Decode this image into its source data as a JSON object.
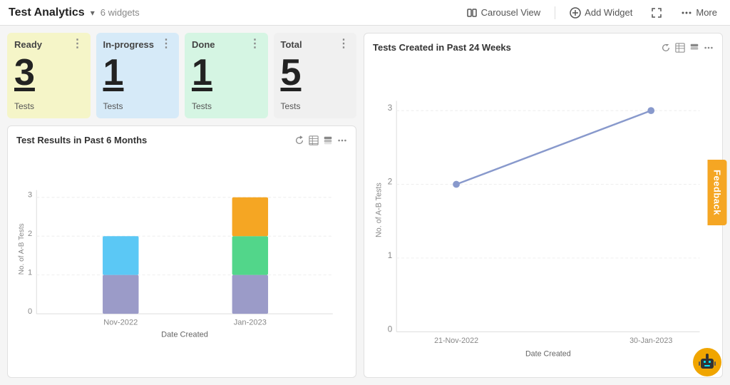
{
  "header": {
    "title": "Test Analytics",
    "arrow": "▾",
    "widgets_label": "6 widgets",
    "carousel_view_label": "Carousel View",
    "add_widget_label": "Add Widget",
    "more_label": "More"
  },
  "stat_cards": [
    {
      "id": "ready",
      "label": "Ready",
      "value": "3",
      "sub_label": "Tests",
      "color_class": "card-ready"
    },
    {
      "id": "inprogress",
      "label": "In-progress",
      "value": "1",
      "sub_label": "Tests",
      "color_class": "card-inprogress"
    },
    {
      "id": "done",
      "label": "Done",
      "value": "1",
      "sub_label": "Tests",
      "color_class": "card-done"
    },
    {
      "id": "total",
      "label": "Total",
      "value": "5",
      "sub_label": "Tests",
      "color_class": "card-total"
    }
  ],
  "bar_chart": {
    "title": "Test Results in Past 6 Months",
    "x_label": "Date Created",
    "y_label": "No. of A-B Tests",
    "bars": [
      {
        "date": "Nov-2022",
        "segments": [
          {
            "value": 1,
            "color": "#9b9bc8"
          },
          {
            "value": 1,
            "color": "#5bc8f5"
          }
        ]
      },
      {
        "date": "Jan-2023",
        "segments": [
          {
            "value": 1,
            "color": "#9b9bc8"
          },
          {
            "value": 1,
            "color": "#52d68a"
          },
          {
            "value": 1,
            "color": "#f5a623"
          }
        ]
      }
    ],
    "y_max": 3,
    "y_ticks": [
      0,
      1,
      2,
      3
    ]
  },
  "line_chart": {
    "title": "Tests Created in Past 24 Weeks",
    "x_label": "Date Created",
    "y_label": "No. of A-B Tests",
    "points": [
      {
        "x_label": "21-Nov-2022",
        "y": 2
      },
      {
        "x_label": "30-Jan-2023",
        "y": 3
      }
    ],
    "y_max": 3,
    "y_ticks": [
      0,
      1,
      2,
      3
    ]
  },
  "feedback": {
    "label": "Feedback"
  }
}
